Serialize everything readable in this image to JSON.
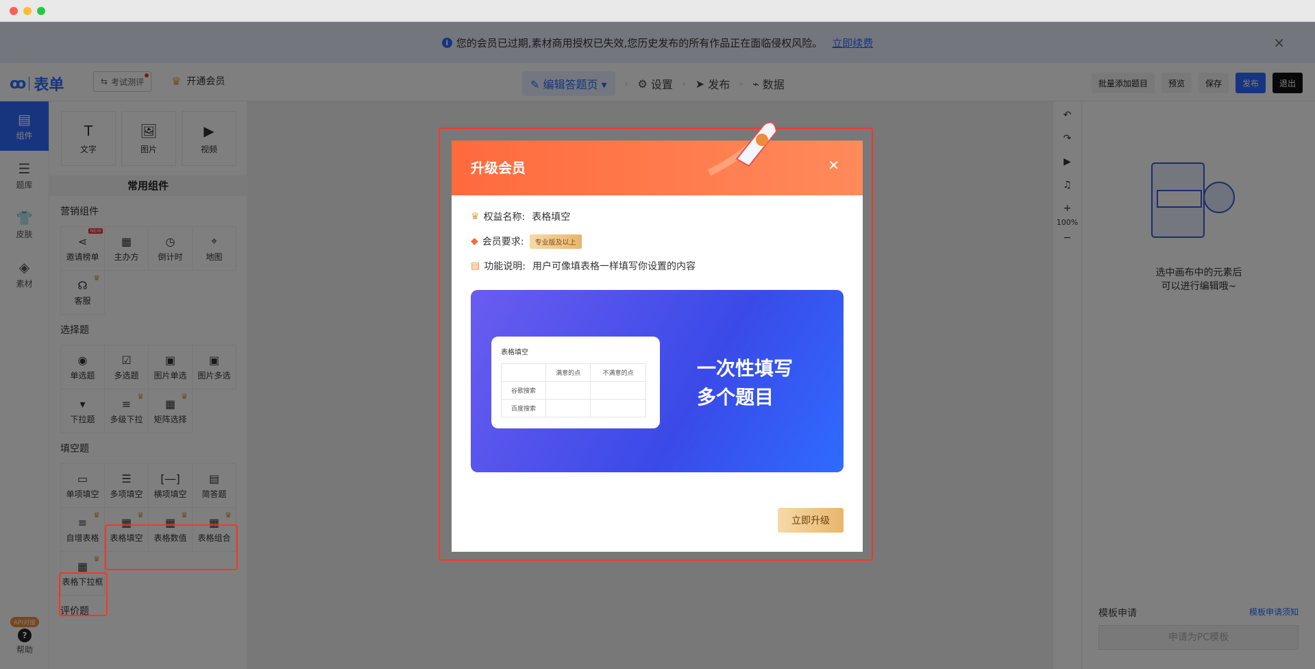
{
  "banner": {
    "message": "您的会员已过期,素材商用授权已失效,您历史发布的所有作品正在面临侵权风险。",
    "renew_link": "立即续费"
  },
  "header": {
    "logo_text": "表单",
    "exam_button": "考试测评",
    "vip_label": "开通会员",
    "nav": {
      "edit": "编辑答题页",
      "settings": "设置",
      "publish": "发布",
      "data": "数据"
    },
    "actions": {
      "batch_add": "批量添加题目",
      "preview": "预览",
      "save": "保存",
      "publish": "发布",
      "exit": "退出"
    }
  },
  "leftnav": {
    "items": [
      "组件",
      "题库",
      "皮肤",
      "素材"
    ],
    "api_badge": "API对接",
    "help": "帮助"
  },
  "panel": {
    "tools": [
      "文字",
      "图片",
      "视频"
    ],
    "common_title": "常用组件",
    "groups": {
      "marketing": {
        "title": "营销组件",
        "items": [
          "邀请榜单",
          "主办方",
          "倒计时",
          "地图",
          "客服"
        ],
        "new_tag": "NEW"
      },
      "choice": {
        "title": "选择题",
        "items": [
          "单选题",
          "多选题",
          "图片单选",
          "图片多选",
          "下拉题",
          "多级下拉",
          "矩阵选择"
        ]
      },
      "fill": {
        "title": "填空题",
        "items": [
          "单项填空",
          "多项填空",
          "横项填空",
          "简答题",
          "自增表格",
          "表格填空",
          "表格数值",
          "表格组合",
          "表格下拉框"
        ]
      },
      "rating": {
        "title": "评价题"
      }
    }
  },
  "right_toolbar": {
    "zoom": "100%"
  },
  "right_panel": {
    "hint_line1": "选中画布中的元素后",
    "hint_line2": "可以进行编辑哦~",
    "template_title": "模板申请",
    "template_notice": "模板申请须知",
    "template_button": "申请为PC模板"
  },
  "dialog": {
    "title": "升级会员",
    "benefit_label": "权益名称:",
    "benefit_value": "表格填空",
    "req_label": "会员要求:",
    "req_badge": "专业版及以上",
    "desc_label": "功能说明:",
    "desc_value": "用户可像填表格一样填写你设置的内容",
    "preview": {
      "card_title": "表格填空",
      "headers": [
        "",
        "满意的点",
        "不满意的点"
      ],
      "rows": [
        "谷歌搜索",
        "百度搜索"
      ],
      "headline1": "一次性填写",
      "headline2": "多个题目"
    },
    "upgrade_button": "立即升级"
  }
}
